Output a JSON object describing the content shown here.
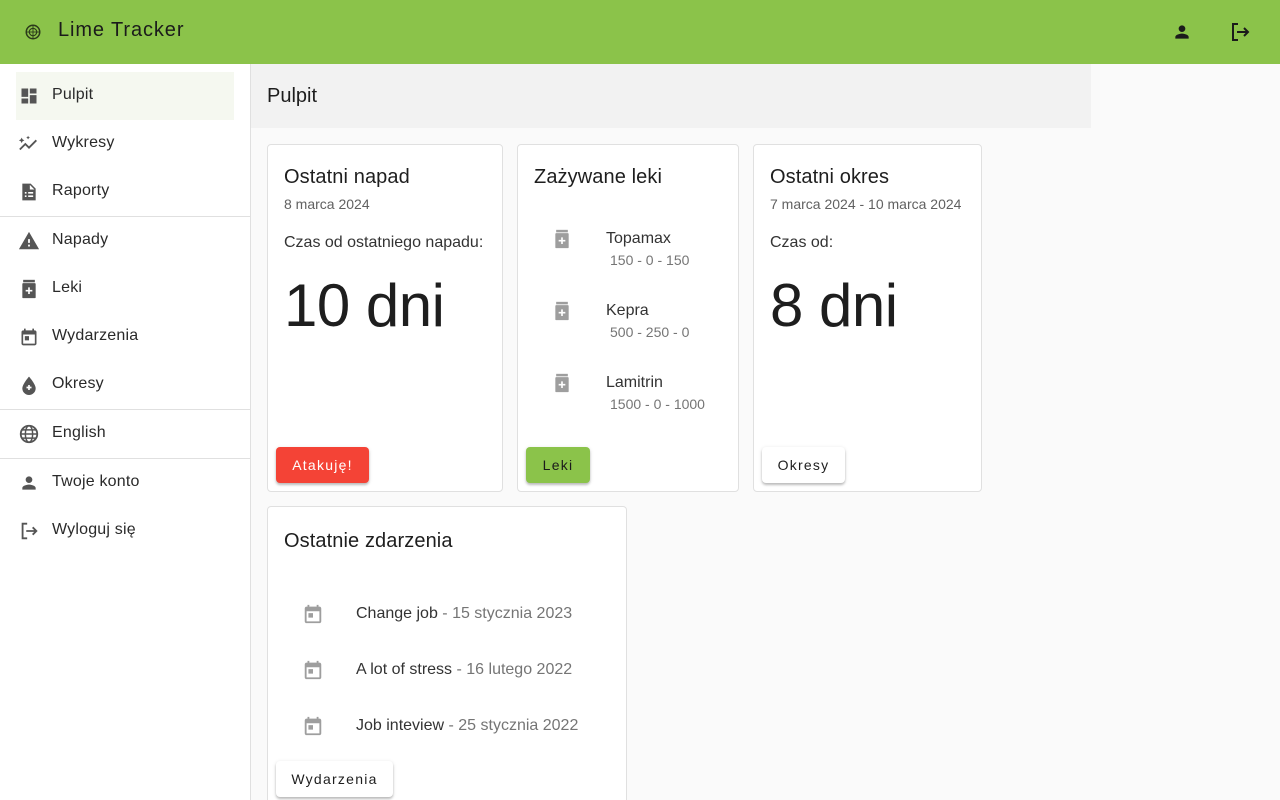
{
  "app": {
    "title": "Lime Tracker"
  },
  "sidebar": {
    "items": [
      {
        "label": "Pulpit",
        "icon": "dashboard-icon"
      },
      {
        "label": "Wykresy",
        "icon": "chart-icon"
      },
      {
        "label": "Raporty",
        "icon": "report-icon"
      },
      {
        "label": "Napady",
        "icon": "warning-icon"
      },
      {
        "label": "Leki",
        "icon": "medication-icon"
      },
      {
        "label": "Wydarzenia",
        "icon": "calendar-icon"
      },
      {
        "label": "Okresy",
        "icon": "drop-icon"
      },
      {
        "label": "English",
        "icon": "globe-icon"
      },
      {
        "label": "Twoje konto",
        "icon": "person-icon"
      },
      {
        "label": "Wyloguj się",
        "icon": "logout-icon"
      }
    ]
  },
  "page": {
    "title": "Pulpit"
  },
  "last_seizure": {
    "title": "Ostatni napad",
    "date": "8 marca 2024",
    "label": "Czas od ostatniego napadu:",
    "value": "10 dni",
    "button": "Atakuję!"
  },
  "medications": {
    "title": "Zażywane leki",
    "items": [
      {
        "name": "Topamax",
        "dose": "150 - 0 - 150"
      },
      {
        "name": "Kepra",
        "dose": "500 - 250 - 0"
      },
      {
        "name": "Lamitrin",
        "dose": "1500 - 0 - 1000"
      }
    ],
    "button": "Leki"
  },
  "last_period": {
    "title": "Ostatni okres",
    "range": "7 marca 2024 - 10 marca 2024",
    "label": "Czas od:",
    "value": "8 dni",
    "button": "Okresy"
  },
  "events": {
    "title": "Ostatnie zdarzenia",
    "items": [
      {
        "name": "Change job",
        "date": " - 15 stycznia 2023"
      },
      {
        "name": "A lot of stress",
        "date": " - 16 lutego 2022"
      },
      {
        "name": "Job inteview",
        "date": " - 25 stycznia 2022"
      }
    ],
    "button": "Wydarzenia"
  },
  "colors": {
    "primary": "#8bc34a",
    "danger": "#f44336"
  }
}
